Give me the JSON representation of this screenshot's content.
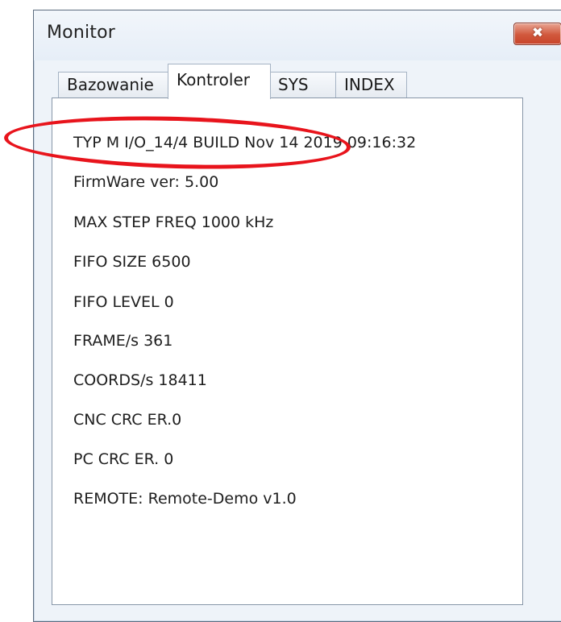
{
  "window": {
    "title": "Monitor",
    "close_label": "✖"
  },
  "tabs": [
    {
      "label": "Bazowanie",
      "active": false
    },
    {
      "label": "Kontroler",
      "active": true
    },
    {
      "label": "SYS",
      "active": false
    },
    {
      "label": "INDEX",
      "active": false
    }
  ],
  "panel": {
    "lines": [
      "TYP M I/O_14/4 BUILD Nov 14 2019 09:16:32",
      "FirmWare ver: 5.00",
      "MAX STEP FREQ 1000 kHz",
      "FIFO SIZE 6500",
      "FIFO LEVEL 0",
      "FRAME/s 361",
      "COORDS/s 18411",
      "CNC CRC ER.0",
      "PC CRC ER. 0",
      "REMOTE: Remote-Demo v1.0"
    ]
  },
  "annotation": {
    "color": "#e8141c",
    "shape": "ellipse"
  }
}
